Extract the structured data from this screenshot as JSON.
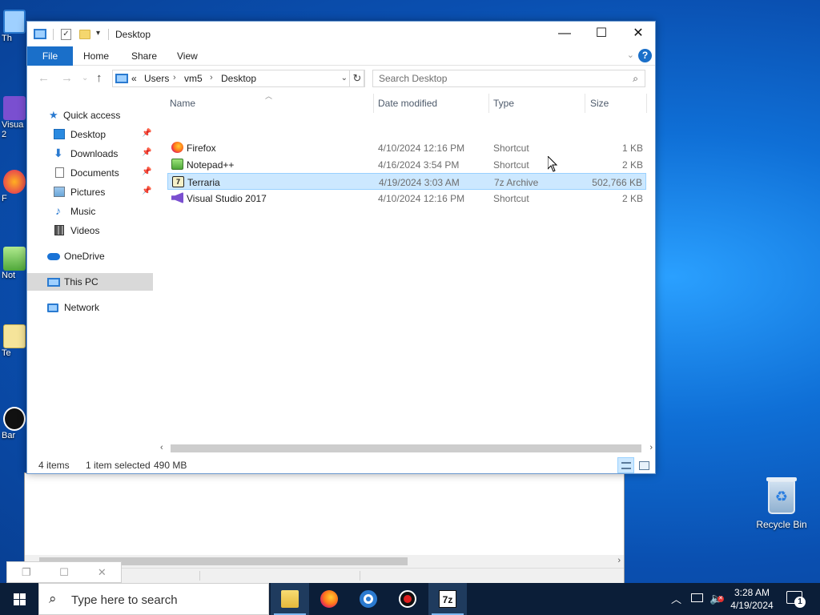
{
  "desktop": {
    "partial_labels": [
      "Th",
      "Visua",
      "2",
      "F",
      "Not",
      "Te",
      "Bar"
    ],
    "recycle_bin": "Recycle Bin"
  },
  "explorer": {
    "title": "Desktop",
    "ribbon_tabs": [
      "File",
      "Home",
      "Share",
      "View"
    ],
    "address": {
      "overflow": "«",
      "crumbs": [
        "Users",
        "vm5",
        "Desktop"
      ]
    },
    "search_placeholder": "Search Desktop",
    "nav_items": [
      {
        "label": "Quick access",
        "icon": "star-icon"
      },
      {
        "label": "Desktop",
        "icon": "desktop-folder-icon",
        "pinned": true
      },
      {
        "label": "Downloads",
        "icon": "download-icon",
        "pinned": true
      },
      {
        "label": "Documents",
        "icon": "documents-icon",
        "pinned": true
      },
      {
        "label": "Pictures",
        "icon": "pictures-icon",
        "pinned": true
      },
      {
        "label": "Music",
        "icon": "music-icon"
      },
      {
        "label": "Videos",
        "icon": "videos-icon"
      },
      {
        "label": "OneDrive",
        "icon": "onedrive-icon"
      },
      {
        "label": "This PC",
        "icon": "this-pc-icon",
        "selected": true
      },
      {
        "label": "Network",
        "icon": "network-icon"
      }
    ],
    "columns": [
      "Name",
      "Date modified",
      "Type",
      "Size"
    ],
    "files": [
      {
        "name": "Firefox",
        "date": "4/10/2024 12:16 PM",
        "type": "Shortcut",
        "size": "1 KB",
        "icon": "firefox-icon"
      },
      {
        "name": "Notepad++",
        "date": "4/16/2024 3:54 PM",
        "type": "Shortcut",
        "size": "2 KB",
        "icon": "notepadpp-icon"
      },
      {
        "name": "Terraria",
        "date": "4/19/2024 3:03 AM",
        "type": "7z Archive",
        "size": "502,766 KB",
        "icon": "7z-archive-icon",
        "selected": true
      },
      {
        "name": "Visual Studio 2017",
        "date": "4/10/2024 12:16 PM",
        "type": "Shortcut",
        "size": "2 KB",
        "icon": "visual-studio-icon"
      }
    ],
    "status": {
      "items": "4 items",
      "selected": "1 item selected",
      "size": "490 MB"
    }
  },
  "taskbar": {
    "search_placeholder": "Type here to search",
    "apps": [
      "file-explorer-icon",
      "firefox-icon",
      "chrome-icon",
      "recorder-icon",
      "7zip-icon"
    ],
    "time": "3:28 AM",
    "date": "4/19/2024",
    "notification_count": "1"
  }
}
